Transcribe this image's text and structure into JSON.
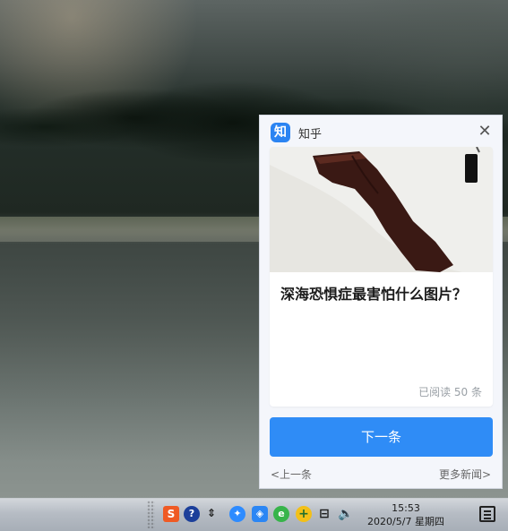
{
  "desktop": {
    "taskbar": {
      "time": "15:53",
      "date": "2020/5/7 星期四",
      "icons": {
        "sogou": "sogou-ime-icon",
        "help": "help-icon",
        "mini": "up-down-icon",
        "bird": "bird-icon",
        "shield": "security-shield-icon",
        "circle": "green-circle-icon",
        "plus": "plus-icon",
        "network": "network-icon",
        "volume": "volume-icon",
        "notification": "notification-center-icon"
      }
    },
    "popup": {
      "app_name": "知乎",
      "logo_text": "知",
      "close_label": "✕",
      "card": {
        "title": "深海恐惧症最害怕什么图片？",
        "meta": "已阅读 50 条"
      },
      "next_button": "下一条",
      "prev_link": "<上一条",
      "more_link": "更多新闻>"
    }
  }
}
